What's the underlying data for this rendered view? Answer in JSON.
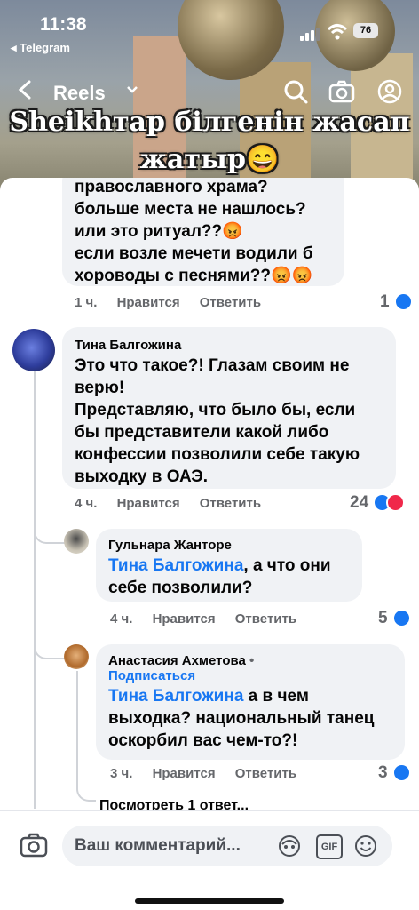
{
  "status_bar": {
    "time": "11:38",
    "back_app": "◂ Telegram",
    "battery": "76"
  },
  "reels_bar": {
    "title": "Reels"
  },
  "overlay": {
    "line1": "Sheikhтар білгенін жасап",
    "line2": "жатыр😄"
  },
  "comments": [
    {
      "partial_lines": [
        "православного храма?",
        "больше места не нашлось?",
        "или это ритуал??😡",
        "если возле мечети водили б",
        "хороводы с песнями??😡😡"
      ],
      "time": "1 ч.",
      "like": "Нравится",
      "reply": "Ответить",
      "count": "1"
    },
    {
      "author": "Тина Балгожина",
      "lines": [
        "Это что такое?! Глазам своим не",
        "верю!",
        "Представляю, что было бы, если",
        "бы представители какой либо",
        "конфессии позволили себе такую",
        "выходку в ОАЭ."
      ],
      "time": "4 ч.",
      "like": "Нравится",
      "reply": "Ответить",
      "count": "24"
    },
    {
      "author": "Гульнара Жанторе",
      "mention": "Тина Балгожина",
      "lines": [
        ", а что они",
        "себе позволили?"
      ],
      "time": "4 ч.",
      "like": "Нравится",
      "reply": "Ответить",
      "count": "5"
    },
    {
      "author": "Анастасия Ахметова",
      "dot": " •",
      "follow": "Подписаться",
      "mention": "Тина Балгожина",
      "lines": [
        " а в чем",
        "выходка? национальный танец",
        "оскорбил вас чем-то?!"
      ],
      "time": "3 ч.",
      "like": "Нравится",
      "reply": "Ответить",
      "count": "3"
    }
  ],
  "view_more": "Посмотреть 1 ответ...",
  "composer": {
    "placeholder": "Ваш комментарий...",
    "gif_label": "GIF"
  },
  "colors": {
    "accent": "#1877f2",
    "bubble": "#f0f2f5",
    "meta": "#65676b",
    "heart": "#f0284a"
  }
}
